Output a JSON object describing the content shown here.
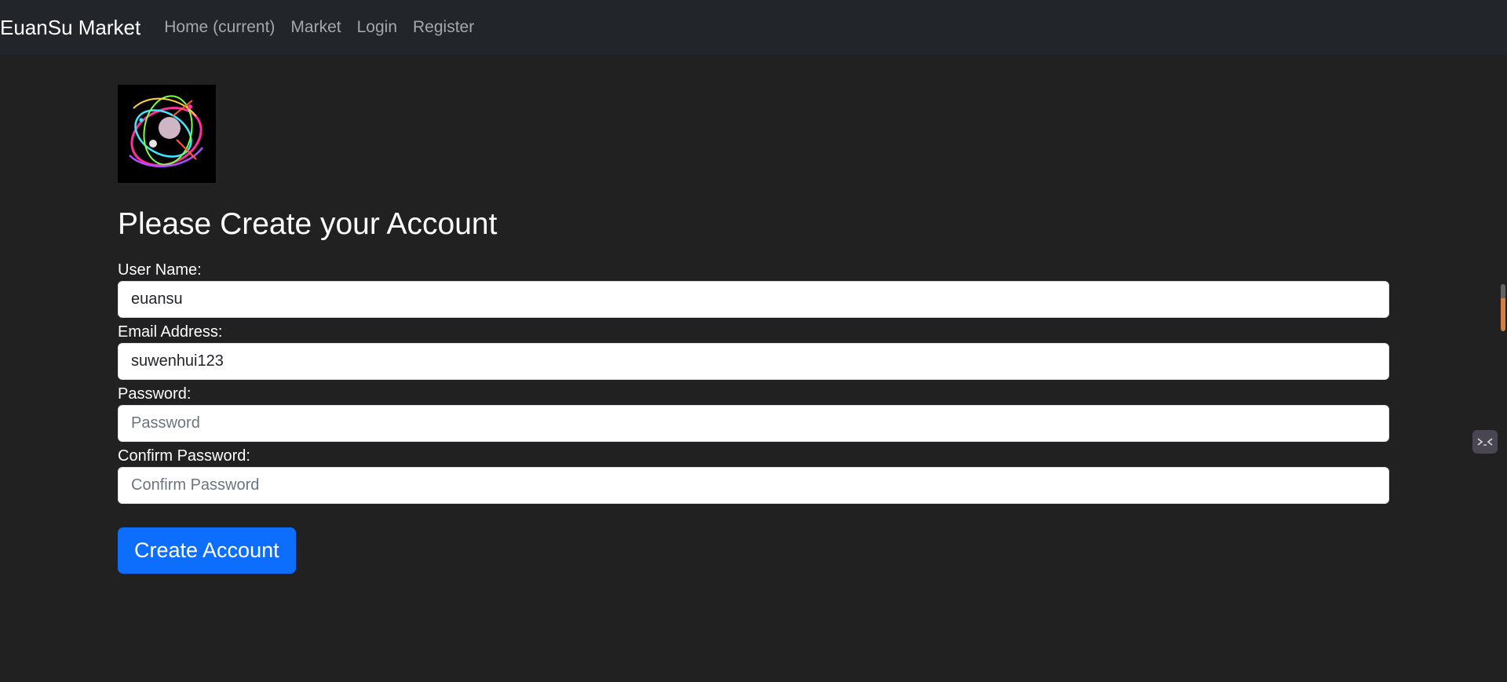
{
  "navbar": {
    "brand": "EuanSu Market",
    "links": [
      {
        "label": "Home (current)"
      },
      {
        "label": "Market"
      },
      {
        "label": "Login"
      },
      {
        "label": "Register"
      }
    ]
  },
  "form": {
    "title": "Please Create your Account",
    "fields": [
      {
        "label": "User Name:",
        "value": "euansu",
        "placeholder": ""
      },
      {
        "label": "Email Address:",
        "value": "suwenhui123",
        "placeholder": ""
      },
      {
        "label": "Password:",
        "value": "",
        "placeholder": "Password"
      },
      {
        "label": "Confirm Password:",
        "value": "",
        "placeholder": "Confirm Password"
      }
    ],
    "submit_label": "Create Account"
  },
  "icons": {
    "logo": "neon-art-logo",
    "side_widget": "chat-face-icon"
  },
  "colors": {
    "background": "#212121",
    "navbar": "#22262b",
    "primary_button": "#0d6efd",
    "nav_link": "#a3a8ad"
  }
}
